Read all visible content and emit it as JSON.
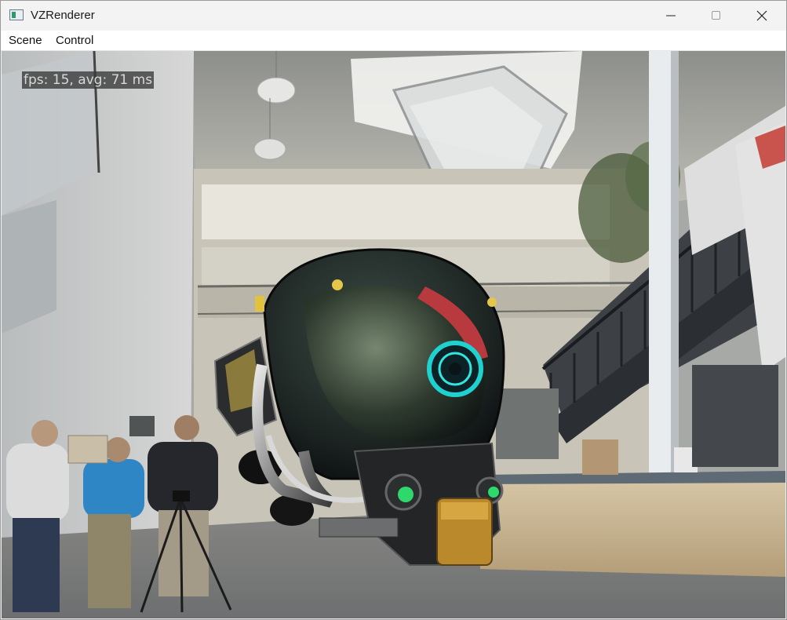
{
  "window": {
    "title": "VZRenderer",
    "controls": {
      "minimize_icon": "minimize-icon",
      "maximize_icon": "maximize-icon",
      "close_icon": "close-icon"
    }
  },
  "menubar": {
    "items": [
      {
        "label": "Scene"
      },
      {
        "label": "Control"
      }
    ]
  },
  "viewport": {
    "overlay_text": "fps: 15, avg: 71 ms"
  }
}
